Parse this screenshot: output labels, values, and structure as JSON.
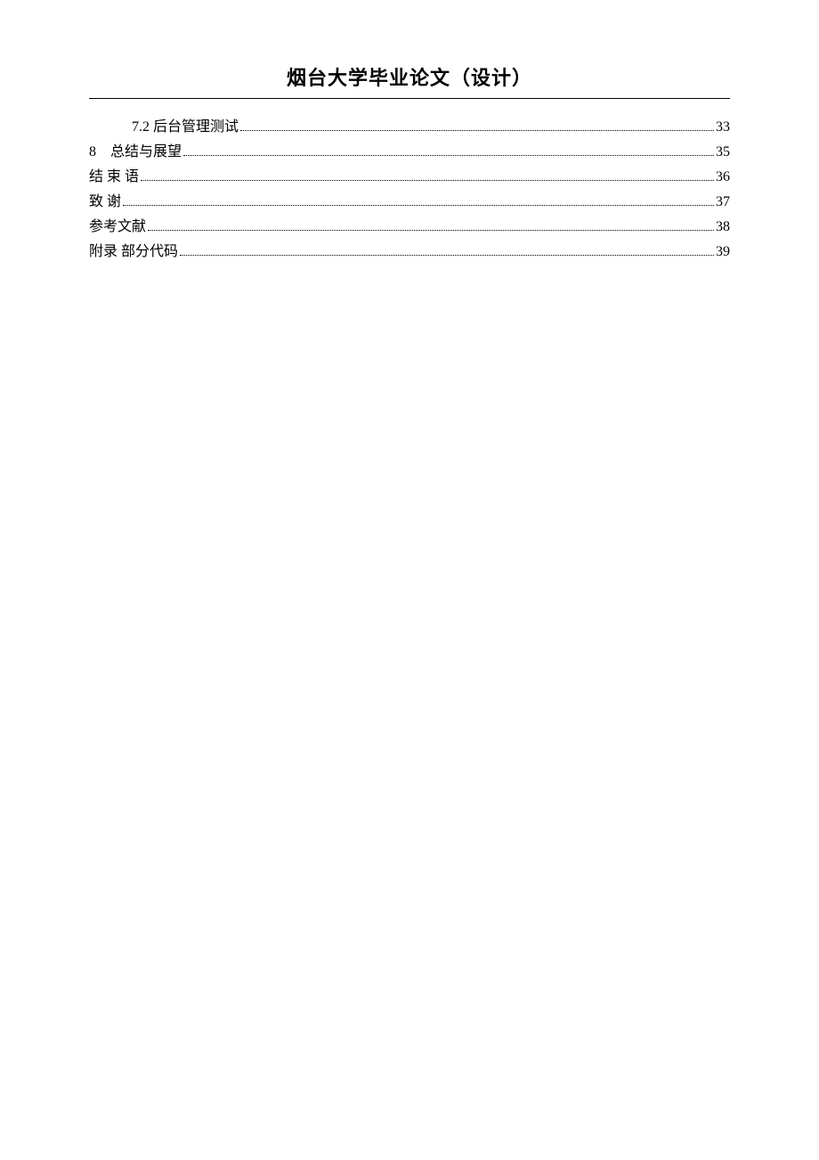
{
  "header": {
    "title": "烟台大学毕业论文（设计）"
  },
  "toc": {
    "entries": [
      {
        "label": "7.2 后台管理测试",
        "page": "33",
        "indent": 1
      },
      {
        "label": "8　总结与展望",
        "page": "35",
        "indent": 0
      },
      {
        "label": "结 束 语",
        "page": "36",
        "indent": 0
      },
      {
        "label": "致 谢",
        "page": "37",
        "indent": 0
      },
      {
        "label": "参考文献",
        "page": "38",
        "indent": 0
      },
      {
        "label": "附录 部分代码",
        "page": "39",
        "indent": 0
      }
    ]
  }
}
